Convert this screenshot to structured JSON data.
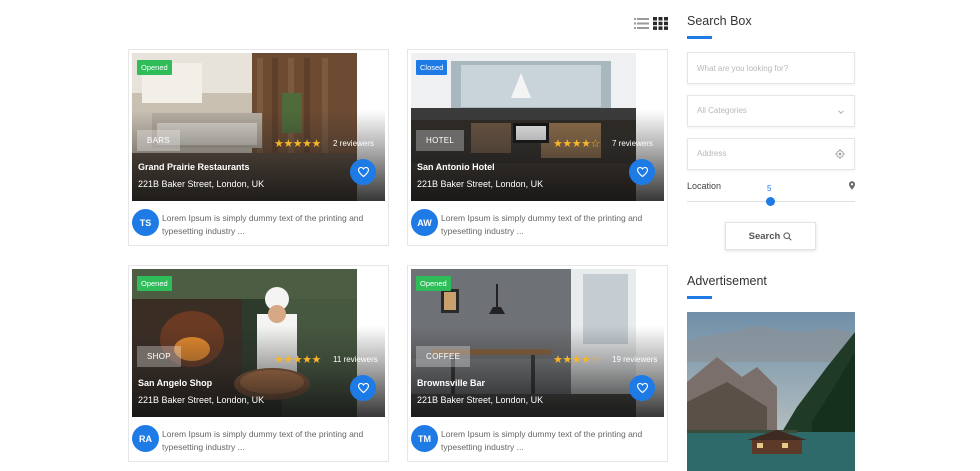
{
  "view_toggle": {
    "list_icon": "list-view-icon",
    "grid_icon": "grid-view-icon"
  },
  "listings": [
    {
      "status": "Opened",
      "category": "BARS",
      "stars": "★★★★★",
      "reviews": "2 reviewers",
      "name": "Grand Prairie Restaurants",
      "address": "221B Baker Street, London, UK",
      "initials": "TS",
      "description": "Lorem Ipsum is simply dummy text of the printing and typesetting industry ..."
    },
    {
      "status": "Closed",
      "category": "HOTEL",
      "stars": "★★★★☆",
      "reviews": "7 reviewers",
      "name": "San Antonio Hotel",
      "address": "221B Baker Street, London, UK",
      "initials": "AW",
      "description": "Lorem Ipsum is simply dummy text of the printing and typesetting industry ..."
    },
    {
      "status": "Opened",
      "category": "SHOP",
      "stars": "★★★★★",
      "reviews": "11 reviewers",
      "name": "San Angelo Shop",
      "address": "221B Baker Street, London, UK",
      "initials": "RA",
      "description": "Lorem Ipsum is simply dummy text of the printing and typesetting industry ..."
    },
    {
      "status": "Opened",
      "category": "COFFEE",
      "stars": "★★★★☆",
      "reviews": "19 reviewers",
      "name": "Brownsville Bar",
      "address": "221B Baker Street, London, UK",
      "initials": "TM",
      "description": "Lorem Ipsum is simply dummy text of the printing and typesetting industry ..."
    }
  ],
  "sidebar": {
    "search_box": {
      "title": "Search Box",
      "keyword_placeholder": "What are you looking for?",
      "category_value": "All Categories",
      "address_placeholder": "Address",
      "location_label": "Location",
      "radius_value": "5",
      "search_label": "Search"
    },
    "advertisement": {
      "title": "Advertisement"
    }
  },
  "colors": {
    "accent": "#1e7be6",
    "opened": "#2ebd59",
    "closed": "#1e7be6",
    "star": "#f6b52a"
  }
}
